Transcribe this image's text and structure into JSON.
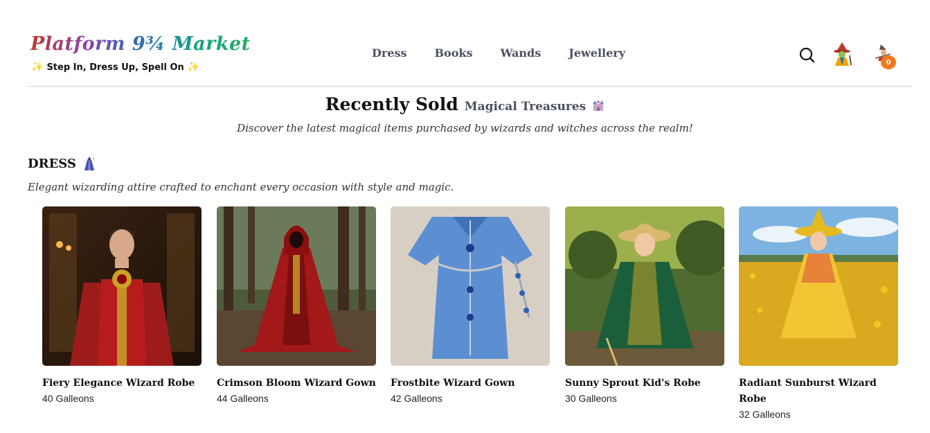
{
  "header": {
    "logo": "Platform 9¾ Market",
    "tagline": "Step In, Dress Up, Spell On",
    "nav": [
      "Dress",
      "Books",
      "Wands",
      "Jewellery"
    ],
    "cart_count": "0"
  },
  "hero": {
    "title": "Recently Sold",
    "title_accent": "Magical Treasures",
    "subtitle": "Discover the latest magical items purchased by wizards and witches across the realm!"
  },
  "category": {
    "name": "DRESS",
    "description": "Elegant wizarding attire crafted to enchant every occasion with style and magic."
  },
  "products": [
    {
      "name": "Fiery Elegance Wizard Robe",
      "price": "40 Galleons"
    },
    {
      "name": "Crimson Bloom Wizard Gown",
      "price": "44 Galleons"
    },
    {
      "name": "Frostbite Wizard Gown",
      "price": "42 Galleons"
    },
    {
      "name": "Sunny Sprout Kid's Robe",
      "price": "30 Galleons"
    },
    {
      "name": "Radiant Sunburst Wizard Robe",
      "price": "32 Galleons"
    }
  ],
  "colors": {
    "nav_text": "#4a5060",
    "badge": "#f07b1d",
    "divider": "#d9d9d9"
  },
  "icons": [
    "search-icon",
    "wizard-account-icon",
    "cart-icon",
    "sparkle-icon",
    "castle-icon",
    "robe-icon"
  ]
}
